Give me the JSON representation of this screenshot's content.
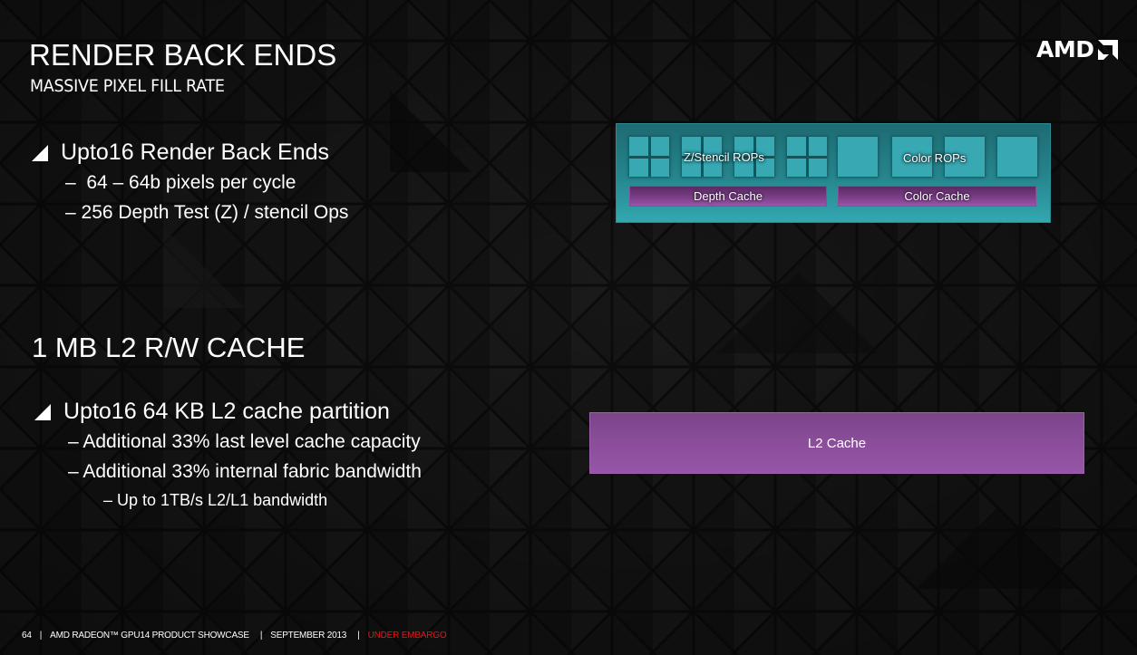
{
  "slide": {
    "title": "RENDER BACK ENDS",
    "subtitle": "MASSIVE PIXEL FILL RATE",
    "logo": {
      "text": "AMD",
      "icon": "amd-arrow-icon"
    },
    "section1": {
      "bullet": "Upto16 Render Back Ends",
      "subbullets": [
        "–  64 – 64b pixels per cycle",
        "– 256 Depth Test (Z) / stencil Ops"
      ]
    },
    "section2": {
      "heading": "1 MB L2 R/W CACHE",
      "bullet": "Upto16 64 KB L2 cache partition",
      "subbullets": [
        "– Additional 33% last level cache capacity",
        "– Additional 33% internal fabric bandwidth"
      ],
      "subsubbullets": [
        "– Up to 1TB/s L2/L1 bandwidth"
      ]
    },
    "rbe_diagram": {
      "zstencil_label": "Z/Stencil ROPs",
      "color_label": "Color ROPs",
      "depth_cache_label": "Depth Cache",
      "color_cache_label": "Color Cache",
      "zstencil_rop_count": 4,
      "color_rop_count": 4,
      "colors": {
        "teal": "#38a8b3",
        "purple": "#7a3e87"
      }
    },
    "l2_diagram": {
      "label": "L2 Cache",
      "color": "#9655a8"
    },
    "footer": {
      "page": "64",
      "event": "AMD RADEON™ GPU14 PRODUCT SHOWCASE",
      "date": "SEPTEMBER 2013",
      "notice": "UNDER EMBARGO",
      "separator": "|",
      "notice_color": "#e01818"
    }
  }
}
